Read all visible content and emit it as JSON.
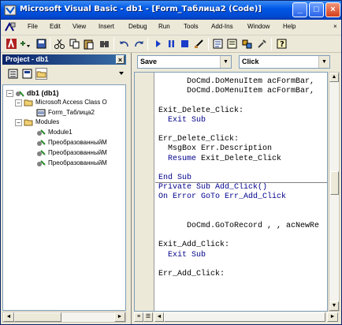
{
  "window": {
    "title": "Microsoft Visual Basic - db1 - [Form_Таблица2 (Code)]",
    "minimize": "_",
    "maximize": "□",
    "close": "×"
  },
  "menu": [
    "File",
    "Edit",
    "View",
    "Insert",
    "Debug",
    "Run",
    "Tools",
    "Add-Ins",
    "Window",
    "Help"
  ],
  "project": {
    "title": "Project - db1",
    "close": "×",
    "tree": {
      "root": "db1 (db1)",
      "folder1": "Microsoft Access Class O",
      "form": "Form_Таблица2",
      "folder2": "Modules",
      "modules": [
        "Module1",
        "ПреобразованныйМ",
        "ПреобразованныйМ",
        "ПреобразованныйМ"
      ]
    }
  },
  "code": {
    "object_combo": "Save",
    "proc_combo": "Click",
    "lines": [
      {
        "text": "DoCmd.DoMenuItem acFormBar,",
        "indent": 3,
        "kw": false
      },
      {
        "text": "DoCmd.DoMenuItem acFormBar,",
        "indent": 3,
        "kw": false
      },
      {
        "text": "",
        "indent": 0,
        "kw": false
      },
      {
        "text": "Exit_Delete_Click:",
        "indent": 0,
        "kw": false
      },
      {
        "text": "Exit Sub",
        "indent": 1,
        "kw": true
      },
      {
        "text": "",
        "indent": 0,
        "kw": false
      },
      {
        "text": "Err_Delete_Click:",
        "indent": 0,
        "kw": false
      },
      {
        "text": "MsgBox Err.Description",
        "indent": 1,
        "kw": false
      },
      {
        "text": "Resume Exit_Delete_Click",
        "indent": 1,
        "kw": false,
        "kwpart": "Resume"
      },
      {
        "text": "",
        "indent": 0,
        "kw": false
      },
      {
        "text": "End Sub",
        "indent": 0,
        "kw": true
      },
      {
        "text": "Private Sub Add_Click()",
        "indent": 0,
        "kw": true
      },
      {
        "text": "On Error GoTo Err_Add_Click",
        "indent": 0,
        "kw": true
      },
      {
        "text": "",
        "indent": 0,
        "kw": false
      },
      {
        "text": "",
        "indent": 0,
        "kw": false
      },
      {
        "text": "DoCmd.GoToRecord , , acNewRe",
        "indent": 3,
        "kw": false
      },
      {
        "text": "",
        "indent": 0,
        "kw": false
      },
      {
        "text": "Exit_Add_Click:",
        "indent": 0,
        "kw": false
      },
      {
        "text": "Exit Sub",
        "indent": 1,
        "kw": true
      },
      {
        "text": "",
        "indent": 0,
        "kw": false
      },
      {
        "text": "Err_Add_Click:",
        "indent": 0,
        "kw": false
      }
    ]
  }
}
